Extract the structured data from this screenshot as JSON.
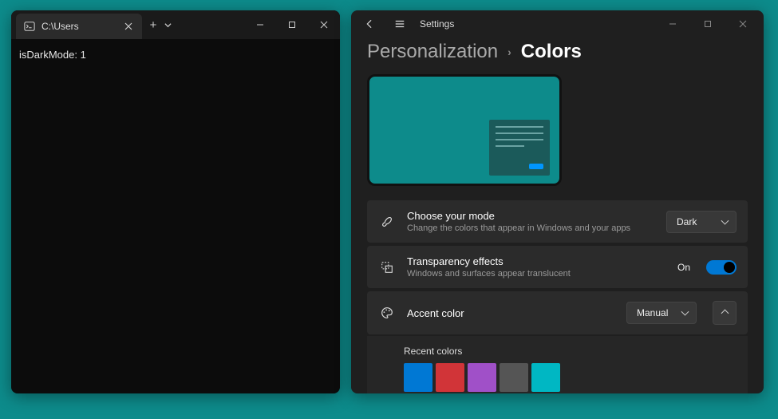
{
  "terminal": {
    "tab_title": "C:\\Users",
    "output_line": "isDarkMode: 1"
  },
  "settings": {
    "app_title": "Settings",
    "breadcrumb_parent": "Personalization",
    "breadcrumb_current": "Colors",
    "mode": {
      "title": "Choose your mode",
      "desc": "Change the colors that appear in Windows and your apps",
      "value": "Dark"
    },
    "transparency": {
      "title": "Transparency effects",
      "desc": "Windows and surfaces appear translucent",
      "state_label": "On",
      "on": true
    },
    "accent": {
      "title": "Accent color",
      "value": "Manual",
      "recent_label": "Recent colors",
      "recent": [
        "#0078d4",
        "#d13438",
        "#a050c8",
        "#555555",
        "#00b7c3"
      ]
    }
  }
}
